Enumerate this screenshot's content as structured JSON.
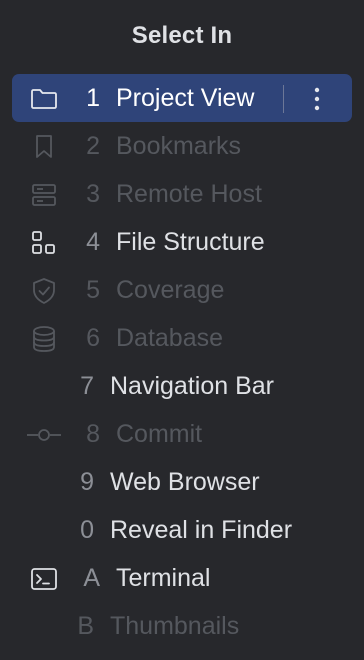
{
  "popup": {
    "title": "Select In",
    "items": [
      {
        "number": "1",
        "label": "Project View",
        "icon": "folder-icon",
        "enabled": true,
        "selected": true
      },
      {
        "number": "2",
        "label": "Bookmarks",
        "icon": "bookmark-icon",
        "enabled": false
      },
      {
        "number": "3",
        "label": "Remote Host",
        "icon": "server-icon",
        "enabled": false
      },
      {
        "number": "4",
        "label": "File Structure",
        "icon": "structure-icon",
        "enabled": true
      },
      {
        "number": "5",
        "label": "Coverage",
        "icon": "shield-icon",
        "enabled": false
      },
      {
        "number": "6",
        "label": "Database",
        "icon": "database-icon",
        "enabled": false
      },
      {
        "number": "7",
        "label": "Navigation Bar",
        "icon": "",
        "enabled": true
      },
      {
        "number": "8",
        "label": "Commit",
        "icon": "commit-icon",
        "enabled": false
      },
      {
        "number": "9",
        "label": "Web Browser",
        "icon": "",
        "enabled": true
      },
      {
        "number": "0",
        "label": "Reveal in Finder",
        "icon": "",
        "enabled": true
      },
      {
        "number": "A",
        "label": "Terminal",
        "icon": "terminal-icon",
        "enabled": true
      },
      {
        "number": "B",
        "label": "Thumbnails",
        "icon": "",
        "enabled": false
      }
    ],
    "more_icon": "more-vertical-icon"
  },
  "colors": {
    "background": "#27282c",
    "selection": "#2f4479",
    "text": "#dfe1e5",
    "disabled_text": "#55585e",
    "number": "#8c8f96"
  }
}
